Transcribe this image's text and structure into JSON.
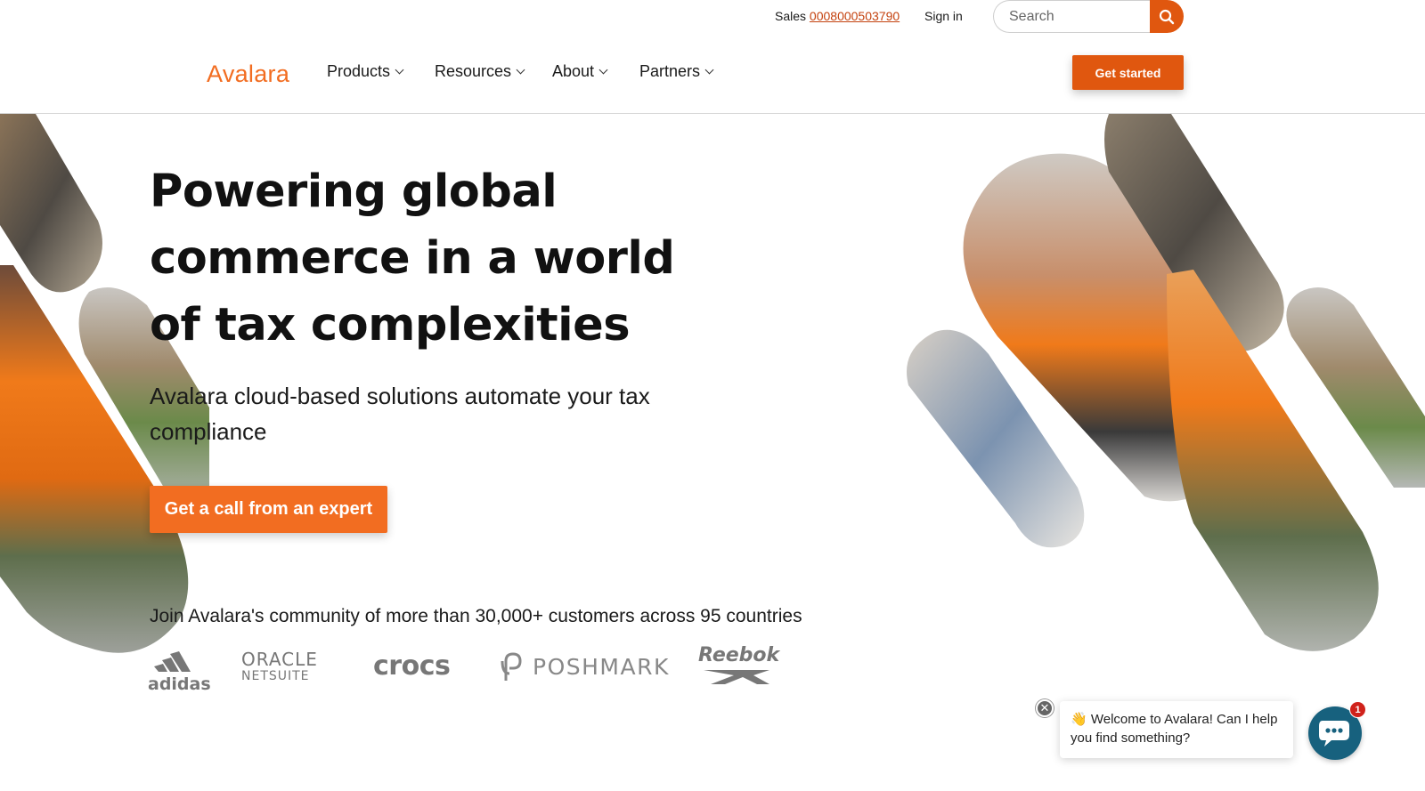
{
  "utility": {
    "sales_label": "Sales",
    "sales_phone": "0008000503790",
    "signin_label": "Sign in",
    "search_placeholder": "Search",
    "search_icon": "search-icon"
  },
  "nav": {
    "logo_text": "Avalara",
    "items": [
      {
        "label": "Products"
      },
      {
        "label": "Resources"
      },
      {
        "label": "About"
      },
      {
        "label": "Partners"
      }
    ],
    "cta_label": "Get started"
  },
  "hero": {
    "title_lines": [
      "Powering global",
      "commerce in a world",
      "of tax complexities"
    ],
    "subtitle_lines": [
      "Avalara cloud-based solutions automate your tax",
      "compliance"
    ],
    "cta_label": "Get a call from an expert"
  },
  "community": {
    "text": "Join Avalara's community of more than 30,000+ customers across 95 countries",
    "brands": [
      {
        "name": "adidas"
      },
      {
        "name": "ORACLE",
        "sub": "NETSUITE"
      },
      {
        "name": "crocs"
      },
      {
        "name": "POSHMARK"
      },
      {
        "name": "Reebok"
      }
    ]
  },
  "chat": {
    "message": "👋 Welcome to Avalara! Can I help you find something?",
    "badge_count": "1"
  },
  "colors": {
    "brand_orange": "#f26d21",
    "button_orange": "#e0570f",
    "chat_blue": "#17617e",
    "badge_red": "#d0221b"
  }
}
